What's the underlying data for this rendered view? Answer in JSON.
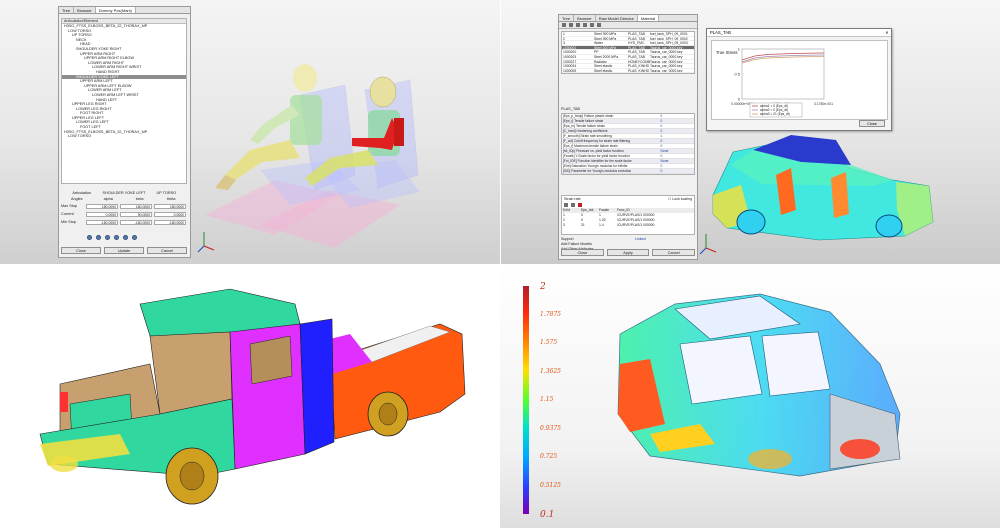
{
  "q1": {
    "tabs": [
      "Tree",
      "Browser",
      "Dummy Pos(Mani)"
    ],
    "tree_header": "Articulation/Element",
    "tree_rows": [
      {
        "text": "H3SO_FTSS_ELBOSS_BETA_22_THORAX_MP",
        "indent": 0
      },
      {
        "text": "LOW TORSO",
        "indent": 1
      },
      {
        "text": "UP TORSO",
        "indent": 2
      },
      {
        "text": "NECK",
        "indent": 3
      },
      {
        "text": "HEAD",
        "indent": 4
      },
      {
        "text": "SHOULDER YOKE RIGHT",
        "indent": 3
      },
      {
        "text": "UPPER ARM RIGHT",
        "indent": 4
      },
      {
        "text": "UPPER ARM RIGHT ELBOW",
        "indent": 5
      },
      {
        "text": "LOWER ARM RIGHT",
        "indent": 6
      },
      {
        "text": "LOWER ARM RIGHT WRIST",
        "indent": 7
      },
      {
        "text": "HAND RIGHT",
        "indent": 8
      },
      {
        "text": "SHOULDER YOKE LEFT",
        "indent": 3,
        "selected": true
      },
      {
        "text": "UPPER ARM LEFT",
        "indent": 4
      },
      {
        "text": "UPPER ARM LEFT ELBOW",
        "indent": 5
      },
      {
        "text": "LOWER ARM LEFT",
        "indent": 6
      },
      {
        "text": "LOWER ARM LEFT WRIST",
        "indent": 7
      },
      {
        "text": "HAND LEFT",
        "indent": 8
      },
      {
        "text": "UPPER LEG RIGHT",
        "indent": 2
      },
      {
        "text": "LOWER LEG RIGHT",
        "indent": 3
      },
      {
        "text": "FOOT RIGHT",
        "indent": 4
      },
      {
        "text": "UPPER LEG LEFT",
        "indent": 2
      },
      {
        "text": "LOWER LEG LEFT",
        "indent": 3
      },
      {
        "text": "FOOT LEFT",
        "indent": 4
      },
      {
        "text": "H3SO_FTSS_ELBOSS_BETA_22_THORAX_MP",
        "indent": 0
      },
      {
        "text": "LOW TORSO",
        "indent": 1
      }
    ],
    "art_title": [
      "Articulation",
      "SHOULDER YOKE LEFT",
      "UP TORSO"
    ],
    "art_cols": [
      "Angles",
      "alpha",
      "beta",
      "theta"
    ],
    "art_rows": [
      {
        "label": "Max Stop",
        "values": [
          "180.0000",
          "180.0000",
          "180.0000"
        ]
      },
      {
        "label": "Current",
        "values": [
          "0.0000",
          "90.0000",
          "0.0000"
        ]
      },
      {
        "label": "Min Stop",
        "values": [
          "-180.0000",
          "-180.0000",
          "-180.0000"
        ]
      }
    ],
    "buttons": [
      "Close",
      "Update",
      "Cancel"
    ]
  },
  "q2": {
    "tabs": [
      "Tree",
      "Browser",
      "Raw Model Director",
      "Material"
    ],
    "mat_rows": [
      {
        "cols": [
          "1",
          "Steel 390 MPa",
          "PLAS_TAB",
          "fuel_tank_SPH_09_0001"
        ],
        "sel": false
      },
      {
        "cols": [
          "2",
          "Steel 390 MPa",
          "PLAS_TAB",
          "fuel_tank_SPH_09_0002"
        ],
        "sel": false
      },
      {
        "cols": [
          "3",
          "Water",
          "HYD_FMC",
          "fuel_tank_SPH_09_0003"
        ],
        "sel": false
      },
      {
        "cols": [
          "1000001",
          "Steel 300 MPa",
          "PLAS_TAB",
          "Taurus_car_0000.key"
        ],
        "sel": true
      },
      {
        "cols": [
          "1000200",
          "PP",
          "PLAS_TAB",
          "Taurus_car_0000.key"
        ],
        "sel": false
      },
      {
        "cols": [
          "1000203",
          "Steel 2000 MPa",
          "PLAS_TAB",
          "Taurus_car_0000.key"
        ],
        "sel": false
      },
      {
        "cols": [
          "1000227",
          "Radiator",
          "HONEYCOMB",
          "Taurus_car_0000.key"
        ],
        "sel": false
      },
      {
        "cols": [
          "1000034",
          "Steel elastic",
          "PLAS_KINHD",
          "Taurus_car_0000.key"
        ],
        "sel": false
      },
      {
        "cols": [
          "1000005",
          "Steel elastic",
          "PLAS_KINHD",
          "Taurus_car_0000.key"
        ],
        "sel": false
      }
    ],
    "prop_title": "PLAS_TAB",
    "prop_rows": [
      {
        "k": "[Eps_p_fstop] Failure plastic strain",
        "v": "0"
      },
      {
        "k": "[Eps_t] Tensile failure strain",
        "v": "0"
      },
      {
        "k": "[Eps_m] Tensile failure strain",
        "v": "0"
      },
      {
        "k": "[C_hard] Hardening coefficient",
        "v": "0"
      },
      {
        "k": "[F_smooth] Strain rate smoothing",
        "v": "1"
      },
      {
        "k": "[F_cut] Cutoff frequency for strain rate filtering",
        "v": "0"
      },
      {
        "k": "[Eps_f] Maximum tensile failure strain",
        "v": "0"
      },
      {
        "k": "[fct_IDp] Pressure vs. yield factor function",
        "v": "None"
      },
      {
        "k": "[Fscale] Y-Scale factor for yield factor function",
        "v": "0"
      },
      {
        "k": "[Fct_IDE] Function identifier for the scale factor",
        "v": "None"
      },
      {
        "k": "[Eint] Saturation Young's modulus for infinite",
        "v": "0"
      },
      {
        "k": "[SID] Parameter for Young's modulus evolution",
        "v": "0"
      }
    ],
    "strain_title": "Strain rate",
    "lock_label": "Lock scaling",
    "strain_head": [
      "N.fct",
      "Eps_dot",
      "Fscale",
      "Func_ID"
    ],
    "strain_rows": [
      [
        "1",
        "0",
        "1",
        "/CURVE/PLAS/1 000000"
      ],
      [
        "2",
        "0",
        "1.02",
        "/CURVE/PLAS/1 000000"
      ],
      [
        "3",
        "21",
        "1.4",
        "/CURVE/PLAS/1 000000"
      ]
    ],
    "support_label": "Support",
    "support_value": "Linked",
    "add_failure": "Add Failure Models",
    "add_other": "Add Other Attributes",
    "foot_buttons": [
      "Close",
      "Apply",
      "Cancel"
    ]
  },
  "dialog": {
    "title": "PLAS_TAB",
    "close_label": "Close",
    "chart_data": {
      "type": "line",
      "ylabel": "True Stress",
      "xlabel": "True Strain",
      "ylim": [
        0,
        1
      ],
      "y_ticks": [
        "0",
        "0.5",
        "1"
      ],
      "x_ticks": [
        "0.00000e+000",
        "1.5000e-001",
        "3.1780e-001"
      ],
      "series": [
        {
          "name": "alpha1 = 0 (Eps_dt)",
          "color": "#c0504d",
          "x": [
            0,
            0.05,
            0.1,
            0.2,
            0.3,
            0.32
          ],
          "y": [
            0.78,
            0.86,
            0.89,
            0.91,
            0.92,
            0.92
          ]
        },
        {
          "name": "alpha2 = 0 (Eps_dt)",
          "color": "#9b8bb0",
          "x": [
            0,
            0.05,
            0.1,
            0.2,
            0.3,
            0.32
          ],
          "y": [
            0.74,
            0.82,
            0.85,
            0.87,
            0.88,
            0.88
          ]
        },
        {
          "name": "alpha3 = 21 (Eps_dt)",
          "color": "#d69d6d",
          "x": [
            0,
            0.05,
            0.1,
            0.2,
            0.3,
            0.32
          ],
          "y": [
            0.72,
            0.79,
            0.82,
            0.84,
            0.85,
            0.85
          ]
        }
      ]
    }
  },
  "legend": {
    "labels": [
      "2",
      "1.7875",
      "1.575",
      "1.3625",
      "1.15",
      "0.9375",
      "0.725",
      "0.5125",
      "0.1"
    ],
    "colors": [
      "#b0202a",
      "#ff2a10",
      "#ff8a00",
      "#ffe000",
      "#55ff30",
      "#00e0c8",
      "#00a8ff",
      "#2a40ff",
      "#7a00b0"
    ]
  },
  "colors": {
    "dummy_skin": "#f2eba0",
    "seat": "#b0b8ff",
    "dummy_red": "#e02020",
    "truck_cab": "#c8a070",
    "truck_green": "#30d8a0",
    "truck_pink": "#e030ff",
    "truck_blue": "#2020ff",
    "truck_orange": "#ff5a10",
    "truck_tire": "#d0a020",
    "car_cyan": "#40e8e0",
    "car_roof": "#2a3acc"
  }
}
